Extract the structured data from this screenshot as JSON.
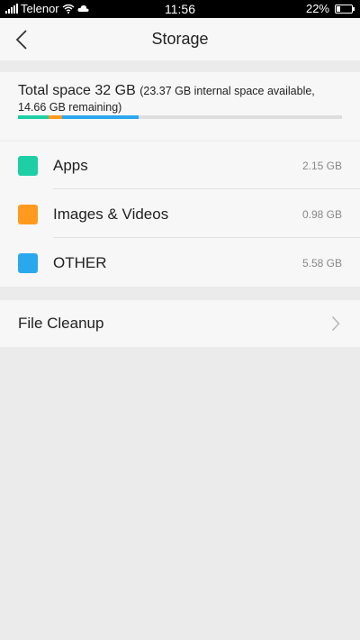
{
  "status_bar": {
    "carrier": "Telenor",
    "time": "11:56",
    "battery": "22%",
    "battery_level": 0.22,
    "icons": [
      "signal-icon",
      "wifi-icon",
      "cloud-icon",
      "battery-icon"
    ]
  },
  "header": {
    "title": "Storage",
    "back_icon": "back-arrow-icon"
  },
  "total": {
    "label": "Total space 32 GB",
    "detail": "(23.37 GB internal space available, 14.66 GB remaining)"
  },
  "usage_bar": [
    {
      "name": "Apps",
      "fraction": 0.094,
      "color": "#1ecfa6"
    },
    {
      "name": "Images & Videos",
      "fraction": 0.042,
      "color": "#ff9a1f"
    },
    {
      "name": "OTHER",
      "fraction": 0.237,
      "color": "#2aa8ee"
    }
  ],
  "categories": [
    {
      "name": "Apps",
      "size": "2.15 GB",
      "color": "#1ecfa6"
    },
    {
      "name": "Images & Videos",
      "size": "0.98 GB",
      "color": "#ff9a1f"
    },
    {
      "name": "OTHER",
      "size": "5.58 GB",
      "color": "#2aa8ee"
    }
  ],
  "file_cleanup": {
    "label": "File Cleanup",
    "icon": "chevron-right-icon"
  }
}
